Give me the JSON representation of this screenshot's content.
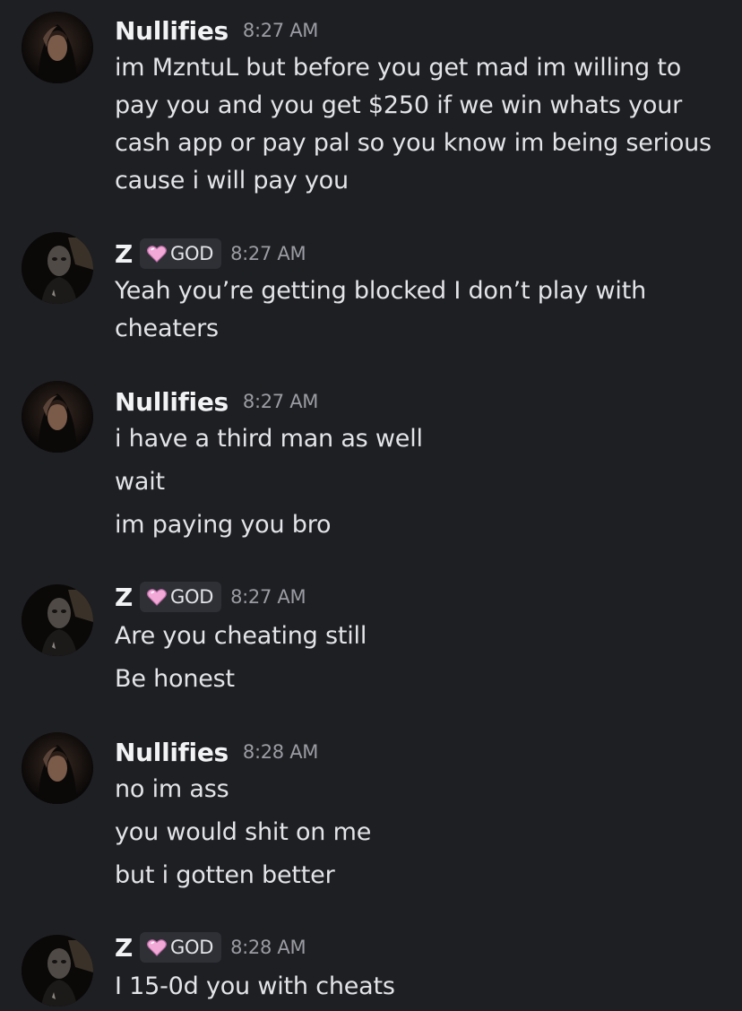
{
  "messages": [
    {
      "author": "Nullifies",
      "time": "8:27 AM",
      "lines": [
        "im MzntuL but before you get mad im willing to",
        "pay you and you get $250 if we win whats your",
        "cash app or pay pal so you know im being serious",
        "cause i will pay you"
      ]
    },
    {
      "author": "Z",
      "role": "GOD",
      "time": "8:27 AM",
      "lines": [
        "Yeah you’re getting blocked I don’t play with",
        "cheaters"
      ]
    },
    {
      "author": "Nullifies",
      "time": "8:27 AM",
      "lines": [
        "i have a third man as well",
        "wait",
        "im paying you bro"
      ]
    },
    {
      "author": "Z",
      "role": "GOD",
      "time": "8:27 AM",
      "lines": [
        "Are you cheating still",
        "Be honest"
      ]
    },
    {
      "author": "Nullifies",
      "time": "8:28 AM",
      "lines": [
        "no im ass",
        "you would shit on me",
        "but i gotten better"
      ]
    },
    {
      "author": "Z",
      "role": "GOD",
      "time": "8:28 AM",
      "lines": [
        "I 15-0d you with cheats"
      ]
    }
  ],
  "role_icon": "pink-heart-icon",
  "colors": {
    "background": "#1e1f23",
    "username": "#f2f3f5",
    "message_text": "#e3e4e8",
    "timestamp": "#9b9ca3",
    "role_tag_bg": "#2e3036",
    "role_heart": "#f2a9d8"
  }
}
